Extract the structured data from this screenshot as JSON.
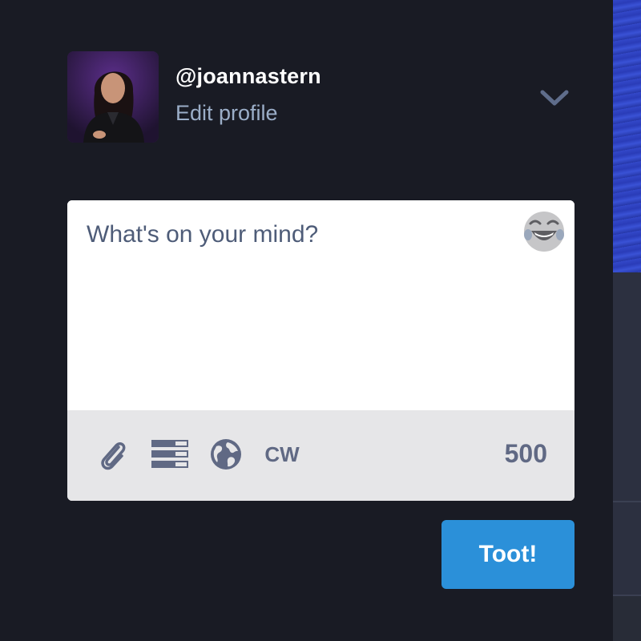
{
  "profile": {
    "username": "@joannastern",
    "edit_profile_label": "Edit profile",
    "avatar_icon": "avatar-photo",
    "menu_icon": "chevron-down-icon"
  },
  "compose": {
    "placeholder": "What's on your mind?",
    "value": "",
    "emoji_icon": "laughing-emoji-icon",
    "toolbar": {
      "attach_icon": "paperclip-icon",
      "poll_icon": "poll-icon",
      "privacy_icon": "globe-icon",
      "cw_label": "CW",
      "char_count": "500"
    },
    "submit_label": "Toot!"
  },
  "colors": {
    "background": "#191b24",
    "accent": "#2b90d9",
    "secondary_text": "#9baec8",
    "toolbar_bg": "#e6e6e8",
    "toolbar_icon": "#606984"
  }
}
